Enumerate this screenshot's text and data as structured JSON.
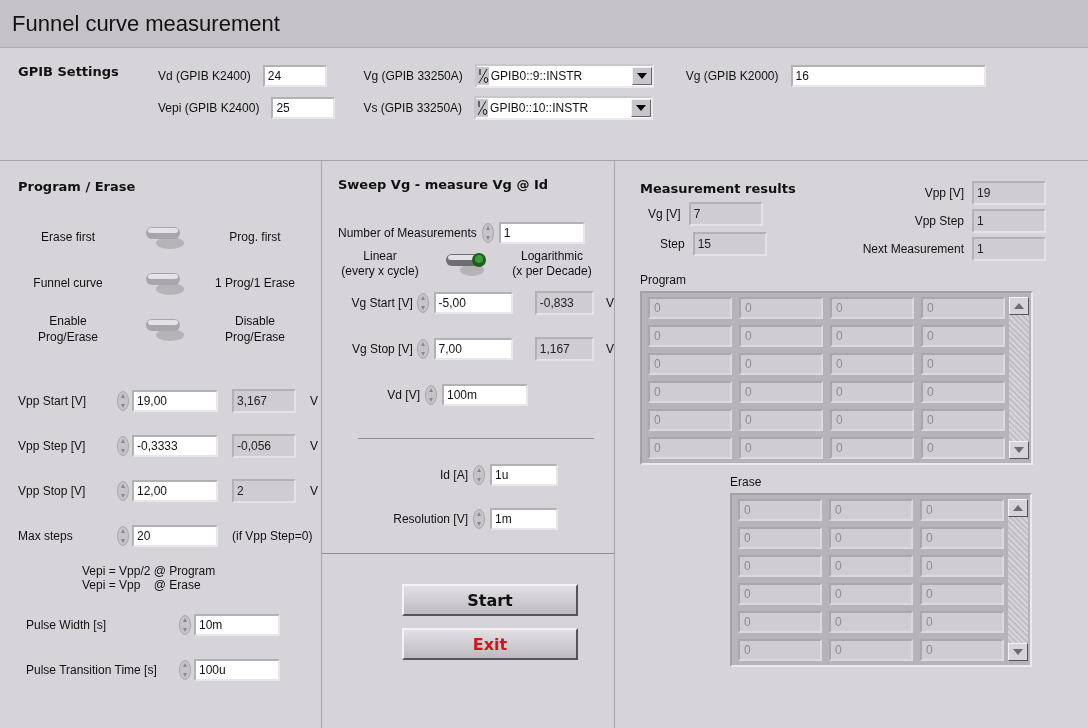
{
  "title": "Funnel curve measurement",
  "gpib": {
    "heading": "GPIB Settings",
    "fields": [
      {
        "label": "Vd (GPIB K2400)",
        "value": "24"
      },
      {
        "label": "Vepi (GPIB K2400)",
        "value": "25"
      }
    ],
    "resources": [
      {
        "label": "Vg (GPIB 33250A)",
        "value": "GPIB0::9::INSTR"
      },
      {
        "label": "Vs (GPIB 33250A)",
        "value": "GPIB0::10::INSTR"
      }
    ],
    "k2000": {
      "label": "Vg (GPIB K2000)",
      "value": "16"
    }
  },
  "program_erase": {
    "heading": "Program / Erase",
    "switches": [
      {
        "left": "Erase first",
        "right": "Prog. first",
        "on": false
      },
      {
        "left": "Funnel curve",
        "right": "1 Prog/1 Erase",
        "on": false
      },
      {
        "left": "Enable\nProg/Erase",
        "right": "Disable\nProg/Erase",
        "on": false
      }
    ],
    "params": [
      {
        "label": "Vpp Start [V]",
        "value": "19,00",
        "readout": "3,167",
        "unit": "V"
      },
      {
        "label": "Vpp Step [V]",
        "value": "-0,3333",
        "readout": "-0,056",
        "unit": "V"
      },
      {
        "label": "Vpp Stop [V]",
        "value": "12,00",
        "readout": "2",
        "unit": "V"
      },
      {
        "label": "Max steps",
        "value": "20",
        "note": "(if Vpp Step=0)"
      }
    ],
    "formula": [
      "Vepi = Vpp/2 @ Program",
      "Vepi = Vpp    @ Erase"
    ],
    "timing": [
      {
        "label": "Pulse Width [s]",
        "value": "10m"
      },
      {
        "label": "Pulse Transition Time [s]",
        "value": "100u"
      }
    ]
  },
  "sweep": {
    "heading": "Sweep Vg - measure Vg @ Id",
    "count": {
      "label": "Number of Measurements",
      "value": "1"
    },
    "mode": {
      "left": "Linear\n(every x cycle)",
      "right": "Logarithmic\n(x per Decade)",
      "on": true
    },
    "params": [
      {
        "label": "Vg Start [V]",
        "value": "-5,00",
        "readout": "-0,833",
        "unit": "V"
      },
      {
        "label": "Vg Stop [V]",
        "value": "7,00",
        "readout": "1,167",
        "unit": "V"
      },
      {
        "label": "Vd [V]",
        "value": "100m"
      }
    ],
    "params2": [
      {
        "label": "Id [A]",
        "value": "1u"
      },
      {
        "label": "Resolution [V]",
        "value": "1m"
      }
    ],
    "buttons": [
      {
        "label": "Start",
        "kind": "normal"
      },
      {
        "label": "Exit",
        "kind": "danger"
      }
    ]
  },
  "results": {
    "heading": "Measurement results",
    "left": [
      {
        "label": "Vg [V]",
        "value": "7"
      },
      {
        "label": "Step",
        "value": "15"
      }
    ],
    "right": [
      {
        "label": "Vpp [V]",
        "value": "19"
      },
      {
        "label": "Vpp Step",
        "value": "1"
      },
      {
        "label": "Next Measurement",
        "value": "1"
      }
    ],
    "program": {
      "label": "Program",
      "rows": [
        [
          "0",
          "0",
          "0",
          "0"
        ],
        [
          "0",
          "0",
          "0",
          "0"
        ],
        [
          "0",
          "0",
          "0",
          "0"
        ],
        [
          "0",
          "0",
          "0",
          "0"
        ],
        [
          "0",
          "0",
          "0",
          "0"
        ],
        [
          "0",
          "0",
          "0",
          "0"
        ]
      ]
    },
    "erase": {
      "label": "Erase",
      "rows": [
        [
          "0",
          "0",
          "0"
        ],
        [
          "0",
          "0",
          "0"
        ],
        [
          "0",
          "0",
          "0"
        ],
        [
          "0",
          "0",
          "0"
        ],
        [
          "0",
          "0",
          "0"
        ],
        [
          "0",
          "0",
          "0"
        ]
      ]
    }
  }
}
